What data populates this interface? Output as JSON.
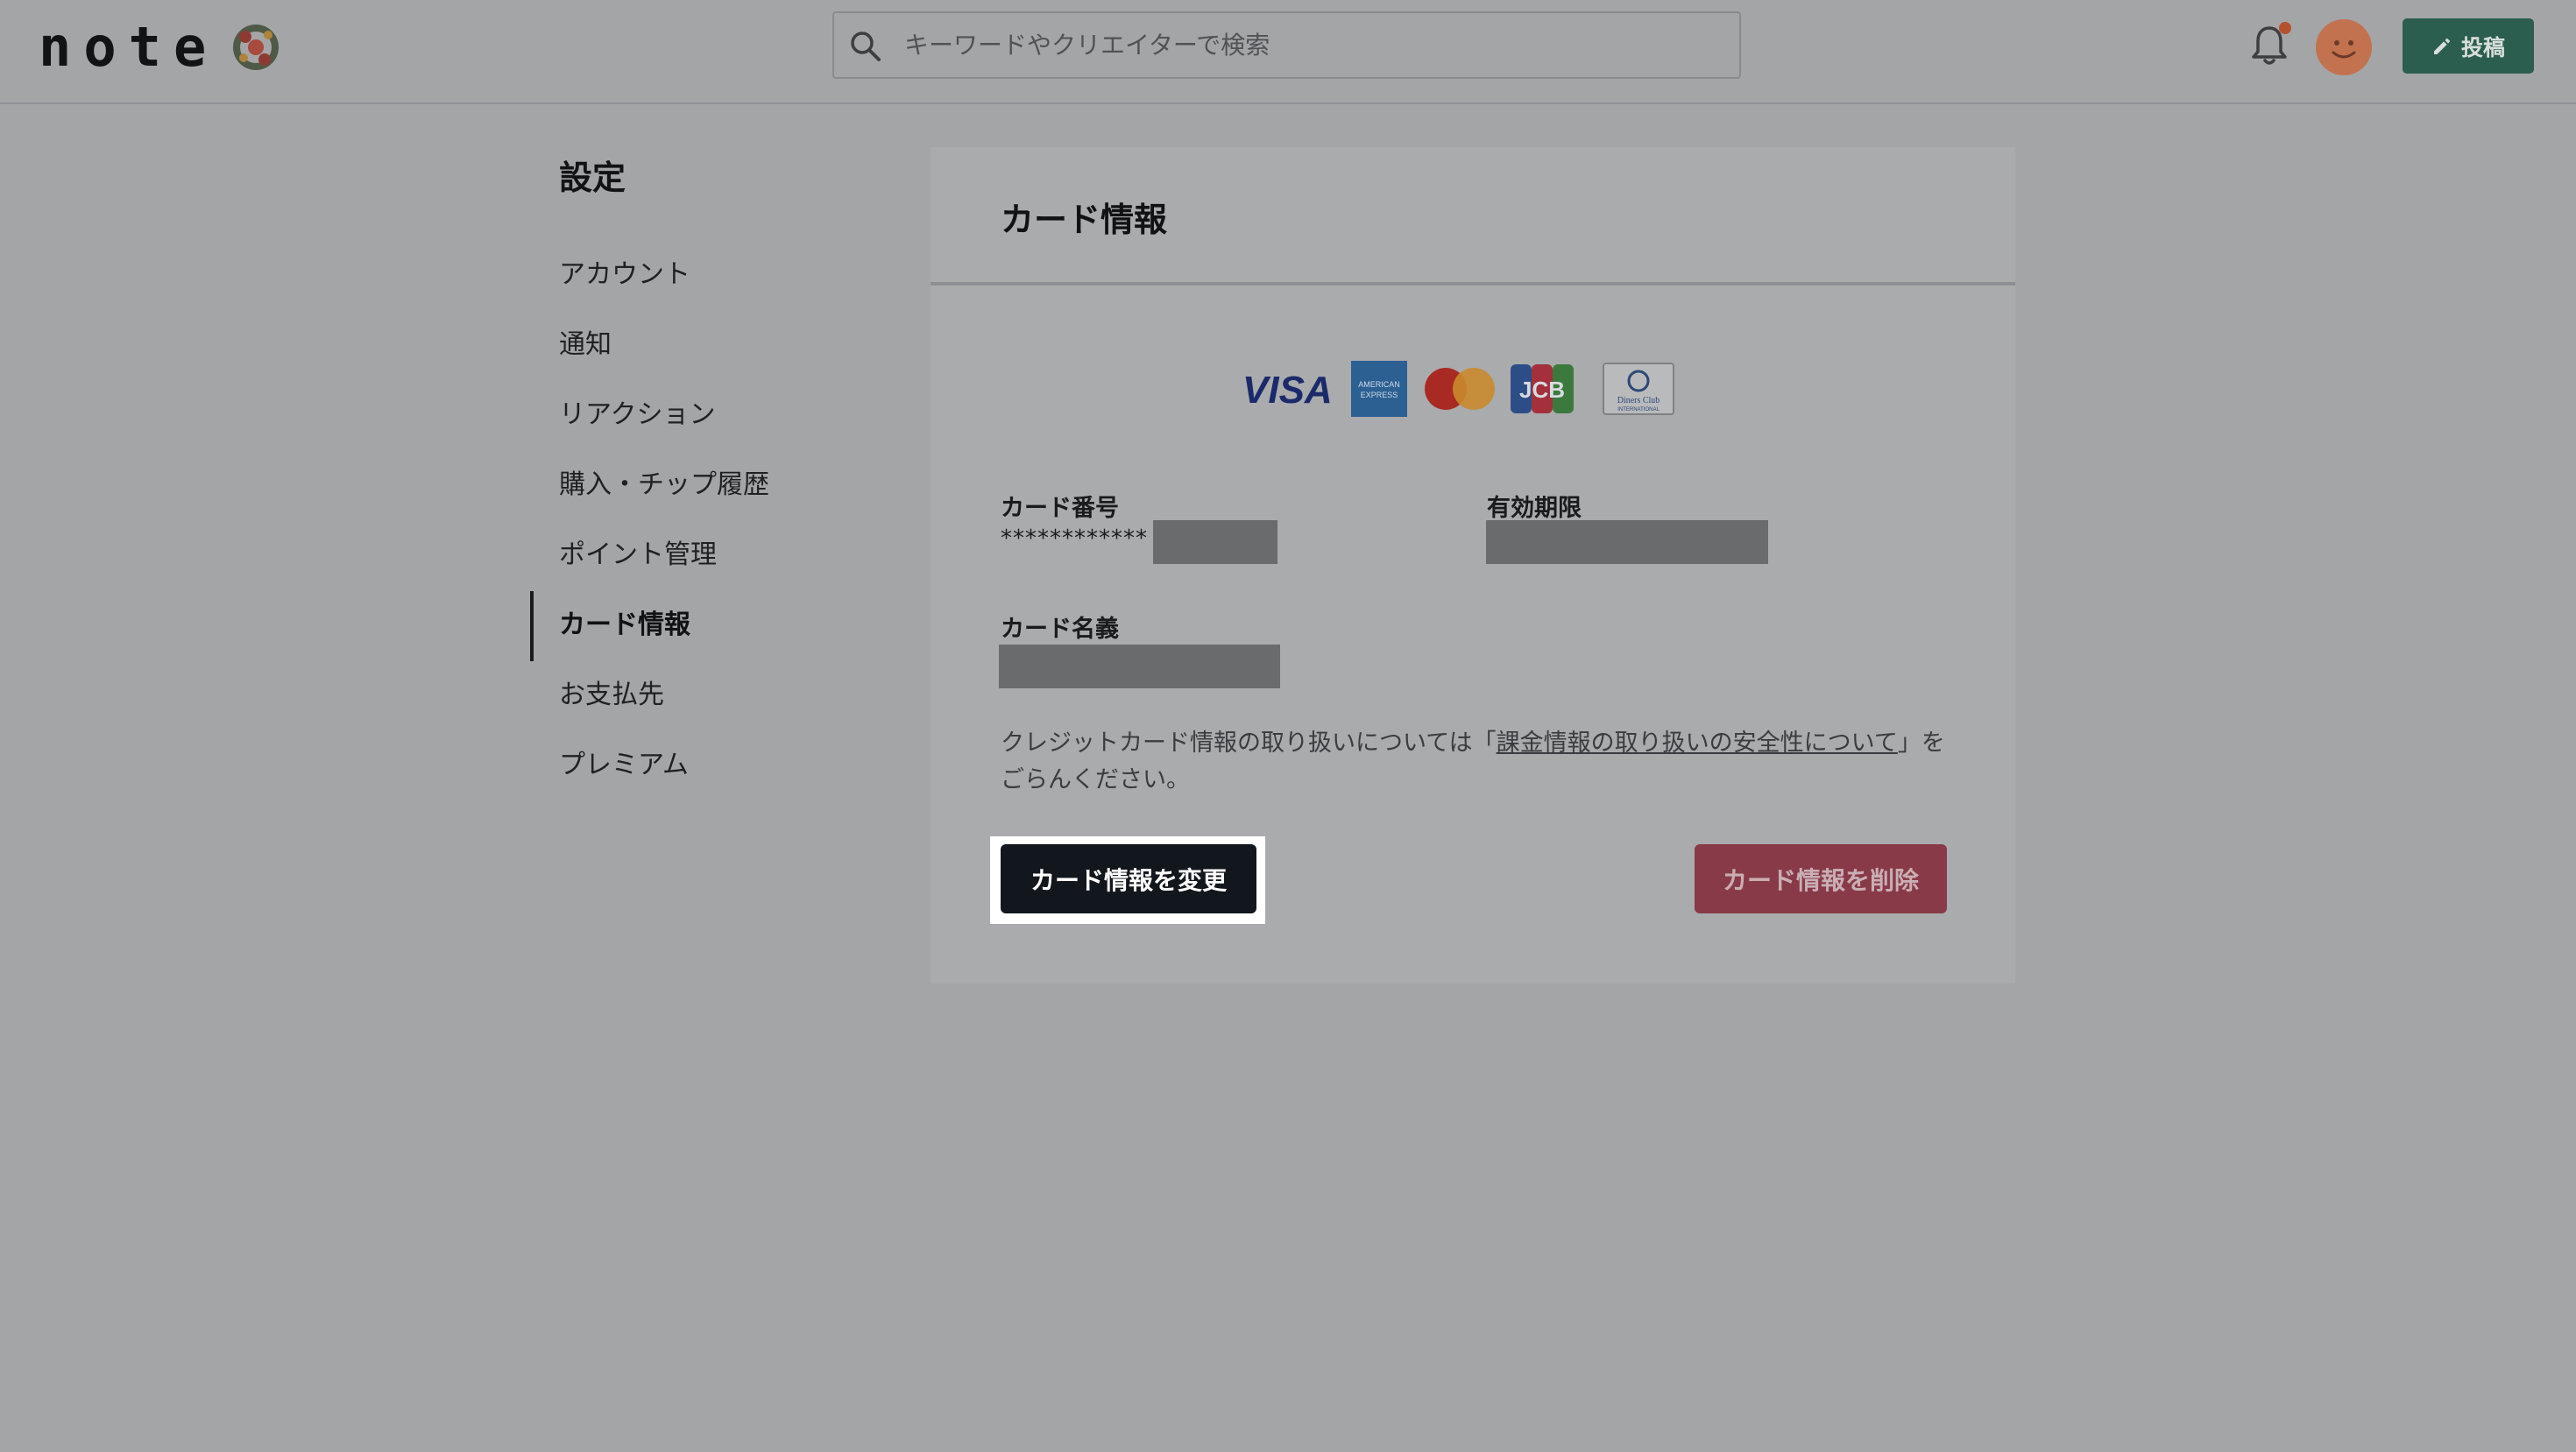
{
  "header": {
    "logo_text": "note",
    "search": {
      "placeholder": "キーワードやクリエイターで検索",
      "value": ""
    },
    "post_button_label": "投稿",
    "accent_color": "#2b5e4e"
  },
  "sidebar": {
    "title": "設定",
    "items": [
      {
        "label": "アカウント",
        "active": false
      },
      {
        "label": "通知",
        "active": false
      },
      {
        "label": "リアクション",
        "active": false
      },
      {
        "label": "購入・チップ履歴",
        "active": false
      },
      {
        "label": "ポイント管理",
        "active": false
      },
      {
        "label": "カード情報",
        "active": true
      },
      {
        "label": "お支払先",
        "active": false
      },
      {
        "label": "プレミアム",
        "active": false
      }
    ]
  },
  "card": {
    "title": "カード情報",
    "brands": [
      "VISA",
      "AMERICAN EXPRESS",
      "Mastercard",
      "JCB",
      "Diners Club INTERNATIONAL"
    ],
    "card_number_label": "カード番号",
    "card_number_masked": "************",
    "expiry_label": "有効期限",
    "card_name_label": "カード名義",
    "note_prefix": "クレジットカード情報の取り扱いについては「",
    "note_link": "課金情報の取り扱いの安全性について",
    "note_suffix": "」をごらんください。",
    "change_button": "カード情報を変更",
    "delete_button": "カード情報を削除",
    "delete_color": "#883a48"
  }
}
